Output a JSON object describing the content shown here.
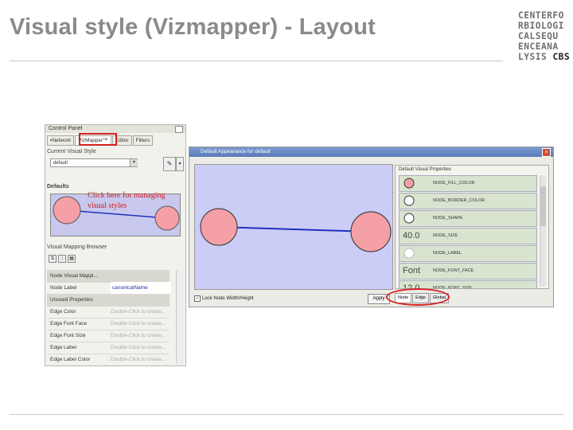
{
  "slide": {
    "title": "Visual style (Vizmapper) - Layout"
  },
  "logo": {
    "lines": [
      "CENTERFO",
      "RBIOLOGI",
      "CALSEQU",
      "ENCEANA",
      "LYSIS"
    ],
    "cbs": "CBS"
  },
  "control_panel": {
    "title": "Control Panel",
    "tabs": [
      "Network",
      "VizMapper™",
      "Editor",
      "Filters"
    ],
    "current_visual_style": {
      "label": "Current Visual Style",
      "value": "default"
    },
    "defaults_label": "Defaults",
    "callout": [
      "Click here for managing",
      "visual styles"
    ],
    "vmb_label": "Visual Mapping Browser",
    "rows": [
      {
        "k": "Node Visual Mappi...",
        "v": "",
        "type": "group"
      },
      {
        "k": "Node Label",
        "v": "canonicalName",
        "type": "lbl"
      },
      {
        "k": "Unused Properties",
        "v": "",
        "type": "group"
      },
      {
        "k": "Edge Color",
        "v": "Double-Click to create...",
        "type": ""
      },
      {
        "k": "Edge Font Face",
        "v": "Double-Click to create...",
        "type": ""
      },
      {
        "k": "Edge Font Size",
        "v": "Double-Click to create...",
        "type": ""
      },
      {
        "k": "Edge Label",
        "v": "Double-Click to create...",
        "type": ""
      },
      {
        "k": "Edge Label Color",
        "v": "Double-Click to create...",
        "type": ""
      }
    ]
  },
  "dialog": {
    "title": "Default Appearance for default",
    "props_title": "Default Visual Properties",
    "props": [
      {
        "label": "NODE_FILL_COLOR",
        "icon": ""
      },
      {
        "label": "NODE_BORDER_COLOR",
        "icon": ""
      },
      {
        "label": "NODE_SHAPE",
        "icon": ""
      },
      {
        "label": "NODE_SIZE",
        "icon": "40.0"
      },
      {
        "label": "NODE_LABEL",
        "icon": ""
      },
      {
        "label": "NODE_FONT_FACE",
        "icon": "Font"
      },
      {
        "label": "NODE_FONT_SIZE",
        "icon": "12.0"
      }
    ],
    "lock_label": "Lock Node Width/Height",
    "apply_label": "Apply",
    "bottom_tabs": [
      "Node",
      "Edge",
      "Global"
    ]
  },
  "colors": {
    "node_fill": "#f5a0a6",
    "canvas": "#cccdf7",
    "edge": "#2030c0",
    "highlight": "#d62020"
  }
}
